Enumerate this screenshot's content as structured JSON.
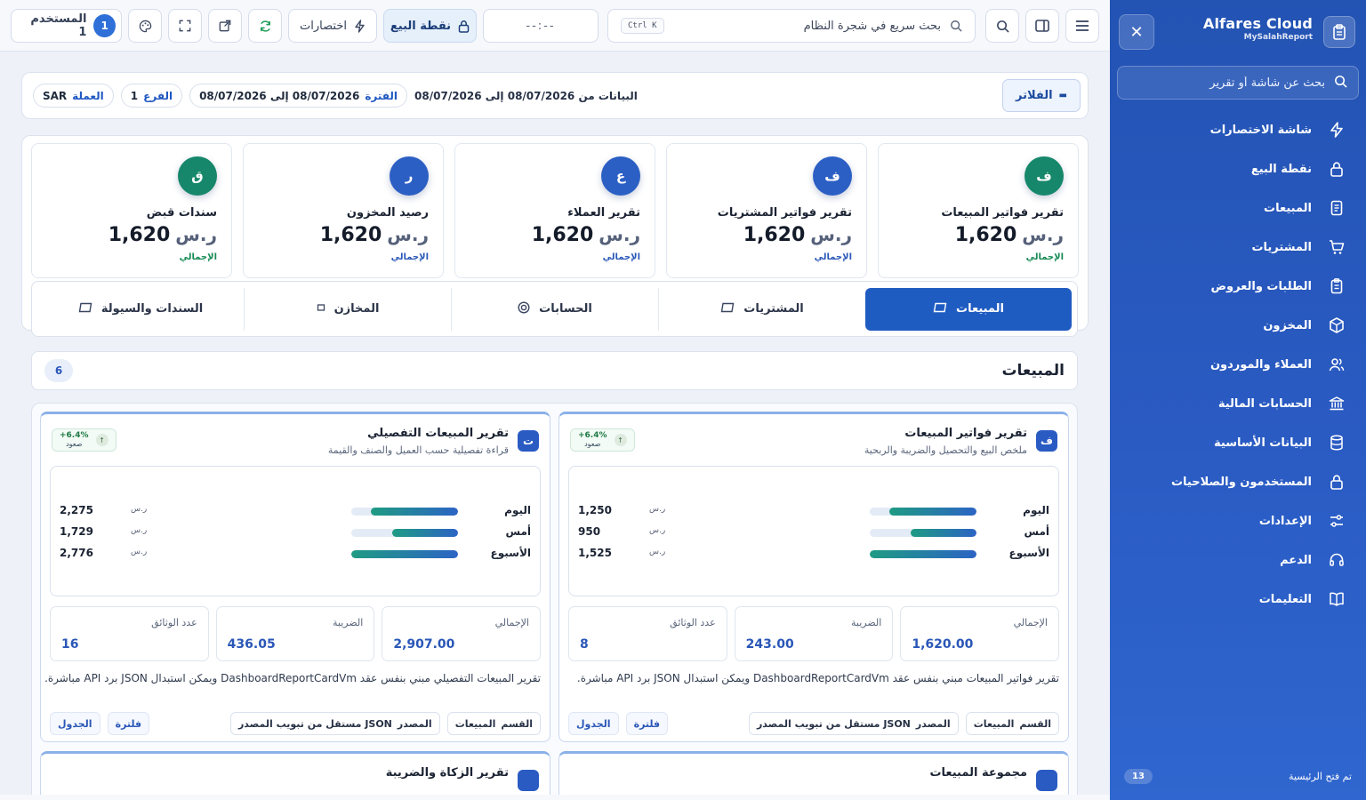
{
  "sidebar": {
    "brand": "Alfares Cloud",
    "brand_sub": "MySalahReport",
    "search_placeholder": "بحث عن شاشة أو تقرير",
    "items": [
      {
        "label": "شاشة الاختصارات",
        "icon": "bolt-icon"
      },
      {
        "label": "نقطة البيع",
        "icon": "lock-icon"
      },
      {
        "label": "المبيعات",
        "icon": "receipt-icon"
      },
      {
        "label": "المشتريات",
        "icon": "cart-icon"
      },
      {
        "label": "الطلبات والعروض",
        "icon": "clipboard-icon"
      },
      {
        "label": "المخزون",
        "icon": "box-icon"
      },
      {
        "label": "العملاء والموردون",
        "icon": "users-icon"
      },
      {
        "label": "الحسابات المالية",
        "icon": "bank-icon"
      },
      {
        "label": "البيانات الأساسية",
        "icon": "database-icon"
      },
      {
        "label": "المستخدمون والصلاحيات",
        "icon": "lock-icon"
      },
      {
        "label": "الإعدادات",
        "icon": "sliders-icon"
      },
      {
        "label": "الدعم",
        "icon": "headset-icon"
      },
      {
        "label": "التعليمات",
        "icon": "book-icon"
      }
    ],
    "footer_text": "تم فتح الرئيسية",
    "footer_count": "13"
  },
  "topbar": {
    "search_label": "بحث سريع في شجرة النظام",
    "search_shortcut": "Ctrl K",
    "time": "--:--",
    "pos_label": "نقطة البيع",
    "shortcuts_label": "اختصارات",
    "user_label": "المستخدم 1",
    "user_badge": "1"
  },
  "filterbar": {
    "filters_label": "الفلاتر",
    "data_range": "البيانات من 08/07/2026 إلى 08/07/2026",
    "period_key": "الفترة",
    "period_value": "08/07/2026 إلى 08/07/2026",
    "branch_key": "الفرع",
    "branch_value": "1",
    "currency_key": "العملة",
    "currency_value": "SAR"
  },
  "kpis": [
    {
      "letter": "ف",
      "title": "تقرير فواتير المبيعات",
      "currency": "ر.س",
      "value": "1,620",
      "label": "الإجمالي",
      "color": "#16876a",
      "label_color": "#168a55"
    },
    {
      "letter": "ف",
      "title": "تقرير فواتير المشتريات",
      "currency": "ر.س",
      "value": "1,620",
      "label": "الإجمالي",
      "color": "#2c5fc4",
      "label_color": "#2a57b7"
    },
    {
      "letter": "ع",
      "title": "تقرير العملاء",
      "currency": "ر.س",
      "value": "1,620",
      "label": "الإجمالي",
      "color": "#2c5fc4",
      "label_color": "#2a57b7"
    },
    {
      "letter": "ر",
      "title": "رصيد المخزون",
      "currency": "ر.س",
      "value": "1,620",
      "label": "الإجمالي",
      "color": "#2c5fc4",
      "label_color": "#2a57b7"
    },
    {
      "letter": "ق",
      "title": "سندات قبض",
      "currency": "ر.س",
      "value": "1,620",
      "label": "الإجمالي",
      "color": "#16876a",
      "label_color": "#168a55"
    }
  ],
  "tabs": [
    {
      "label": "المبيعات",
      "active": true
    },
    {
      "label": "المشتريات",
      "active": false
    },
    {
      "label": "الحسابات",
      "active": false
    },
    {
      "label": "المخازن",
      "active": false
    },
    {
      "label": "السندات والسيولة",
      "active": false
    }
  ],
  "section": {
    "title": "المبيعات",
    "count": "6"
  },
  "cards": [
    {
      "letter": "ف",
      "title": "تقرير فواتير المبيعات",
      "subtitle": "ملخص البيع والتحصيل والضريبة والربحية",
      "trend_value": "+6.4%",
      "trend_label": "صعود",
      "bar_max": 1525,
      "bars": [
        {
          "label": "اليوم",
          "currency": "ر.س",
          "value": 1250,
          "display": "1,250"
        },
        {
          "label": "أمس",
          "currency": "ر.س",
          "value": 950,
          "display": "950"
        },
        {
          "label": "الأسبوع",
          "currency": "ر.س",
          "value": 1525,
          "display": "1,525"
        }
      ],
      "stats": [
        {
          "key": "الإجمالي",
          "value": "1,620.00"
        },
        {
          "key": "الضريبة",
          "value": "243.00"
        },
        {
          "key": "عدد الوثائق",
          "value": "8"
        }
      ],
      "note": "تقرير فواتير المبيعات مبني بنفس عقد DashboardReportCardVm ويمكن استبدال JSON برد API مباشرة.",
      "chip_section_key": "القسم",
      "chip_section_value": "المبيعات",
      "chip_source_key": "المصدر",
      "chip_source_value": "JSON مستقل من تبويب المصدر",
      "filter_label": "فلترة",
      "table_label": "الجدول"
    },
    {
      "letter": "ت",
      "title": "تقرير المبيعات التفصيلي",
      "subtitle": "قراءة تفصيلية حسب العميل والصنف والقيمة",
      "trend_value": "+6.4%",
      "trend_label": "صعود",
      "bar_max": 2776,
      "bars": [
        {
          "label": "اليوم",
          "currency": "ر.س",
          "value": 2275,
          "display": "2,275"
        },
        {
          "label": "أمس",
          "currency": "ر.س",
          "value": 1729,
          "display": "1,729"
        },
        {
          "label": "الأسبوع",
          "currency": "ر.س",
          "value": 2776,
          "display": "2,776"
        }
      ],
      "stats": [
        {
          "key": "الإجمالي",
          "value": "2,907.00"
        },
        {
          "key": "الضريبة",
          "value": "436.05"
        },
        {
          "key": "عدد الوثائق",
          "value": "16"
        }
      ],
      "note": "تقرير المبيعات التفصيلي مبني بنفس عقد DashboardReportCardVm ويمكن استبدال JSON برد API مباشرة.",
      "chip_section_key": "القسم",
      "chip_section_value": "المبيعات",
      "chip_source_key": "المصدر",
      "chip_source_value": "JSON مستقل من تبويب المصدر",
      "filter_label": "فلترة",
      "table_label": "الجدول"
    }
  ],
  "next_cards": [
    {
      "title": "مجموعة المبيعات"
    },
    {
      "title": "تقرير الزكاة والضريبة"
    }
  ]
}
